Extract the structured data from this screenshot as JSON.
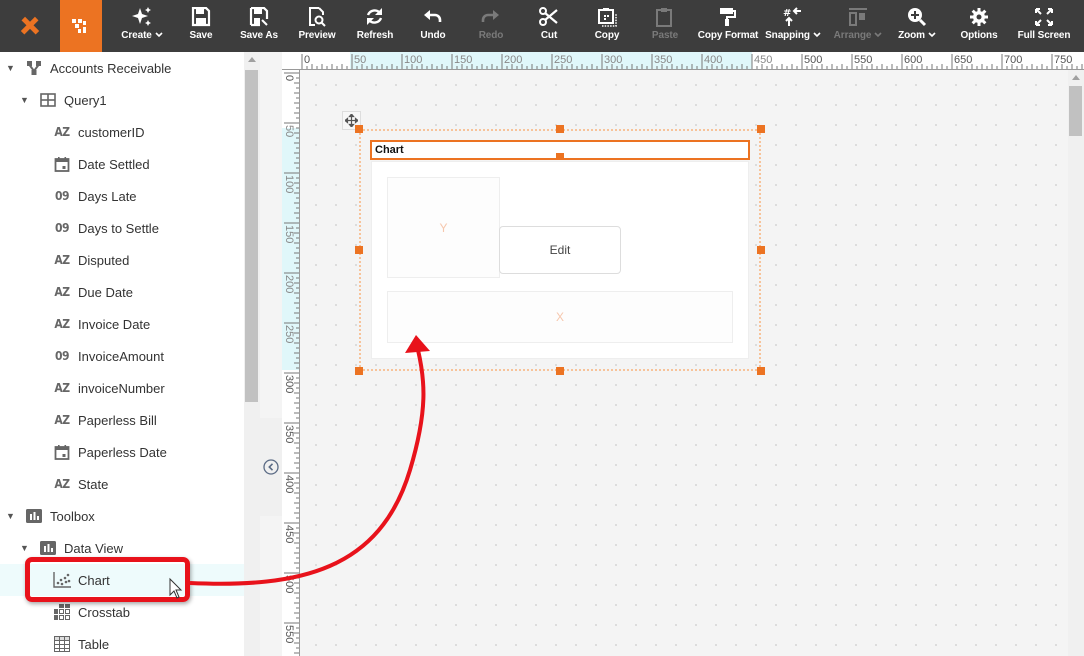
{
  "toolbar": {
    "accent_color": "#ec7322",
    "background_color": "#3d3d3d",
    "buttons": [
      {
        "id": "create",
        "label": "Create",
        "icon": "sparkle-icon",
        "has_dropdown": true,
        "enabled": true
      },
      {
        "id": "save",
        "label": "Save",
        "icon": "save-icon",
        "has_dropdown": false,
        "enabled": true
      },
      {
        "id": "save-as",
        "label": "Save As",
        "icon": "save-as-icon",
        "has_dropdown": false,
        "enabled": true
      },
      {
        "id": "preview",
        "label": "Preview",
        "icon": "preview-icon",
        "has_dropdown": false,
        "enabled": true
      },
      {
        "id": "refresh",
        "label": "Refresh",
        "icon": "refresh-icon",
        "has_dropdown": false,
        "enabled": true
      },
      {
        "id": "undo",
        "label": "Undo",
        "icon": "undo-icon",
        "has_dropdown": false,
        "enabled": true
      },
      {
        "id": "redo",
        "label": "Redo",
        "icon": "redo-icon",
        "has_dropdown": false,
        "enabled": false
      },
      {
        "id": "cut",
        "label": "Cut",
        "icon": "scissors-icon",
        "has_dropdown": false,
        "enabled": true
      },
      {
        "id": "copy",
        "label": "Copy",
        "icon": "copy-icon",
        "has_dropdown": false,
        "enabled": true
      },
      {
        "id": "paste",
        "label": "Paste",
        "icon": "clipboard-icon",
        "has_dropdown": false,
        "enabled": false
      },
      {
        "id": "copy-format",
        "label": "Copy Format",
        "icon": "paint-roller-icon",
        "has_dropdown": false,
        "enabled": true
      },
      {
        "id": "snapping",
        "label": "Snapping",
        "icon": "snapping-icon",
        "has_dropdown": true,
        "enabled": true
      },
      {
        "id": "arrange",
        "label": "Arrange",
        "icon": "arrange-icon",
        "has_dropdown": true,
        "enabled": false
      },
      {
        "id": "zoom",
        "label": "Zoom",
        "icon": "zoom-in-icon",
        "has_dropdown": true,
        "enabled": true
      },
      {
        "id": "options",
        "label": "Options",
        "icon": "gear-icon",
        "has_dropdown": false,
        "enabled": true
      },
      {
        "id": "full-screen",
        "label": "Full Screen",
        "icon": "full-screen-icon",
        "has_dropdown": false,
        "enabled": true
      }
    ]
  },
  "sidebar": {
    "datasource": {
      "label": "Accounts Receivable",
      "icon": "datasource-icon",
      "expanded": true
    },
    "query": {
      "label": "Query1",
      "icon": "table-icon",
      "expanded": true
    },
    "fields": [
      {
        "label": "customerID",
        "type": "AZ"
      },
      {
        "label": "Date Settled",
        "type": "date"
      },
      {
        "label": "Days Late",
        "type": "09"
      },
      {
        "label": "Days to Settle",
        "type": "09"
      },
      {
        "label": "Disputed",
        "type": "AZ"
      },
      {
        "label": "Due Date",
        "type": "AZ"
      },
      {
        "label": "Invoice Date",
        "type": "AZ"
      },
      {
        "label": "InvoiceAmount",
        "type": "09"
      },
      {
        "label": "invoiceNumber",
        "type": "AZ"
      },
      {
        "label": "Paperless Bill",
        "type": "AZ"
      },
      {
        "label": "Paperless Date",
        "type": "date"
      },
      {
        "label": "State",
        "type": "AZ"
      }
    ],
    "toolbox": {
      "label": "Toolbox",
      "expanded": true
    },
    "data_view": {
      "label": "Data View",
      "expanded": true
    },
    "data_view_items": [
      {
        "label": "Chart",
        "icon": "scatter-chart-icon",
        "selected": true
      },
      {
        "label": "Crosstab",
        "icon": "crosstab-icon",
        "selected": false
      },
      {
        "label": "Table",
        "icon": "grid-table-icon",
        "selected": false
      }
    ]
  },
  "rulers": {
    "top_labels": [
      "0",
      "50",
      "100",
      "150",
      "200",
      "250",
      "300",
      "350",
      "400",
      "450",
      "500",
      "550",
      "600",
      "650",
      "700",
      "750"
    ],
    "left_labels": [
      "0",
      "50",
      "100",
      "150",
      "200",
      "250",
      "300",
      "350",
      "400",
      "450",
      "500",
      "550"
    ],
    "highlight_color": "#e0f7fa"
  },
  "canvas": {
    "chart_component": {
      "title": "Chart",
      "y_placeholder": "Y",
      "x_placeholder": "X",
      "edit_label": "Edit"
    }
  },
  "annotation": {
    "color": "#e8121b",
    "description": "drag Chart from toolbox to canvas"
  }
}
